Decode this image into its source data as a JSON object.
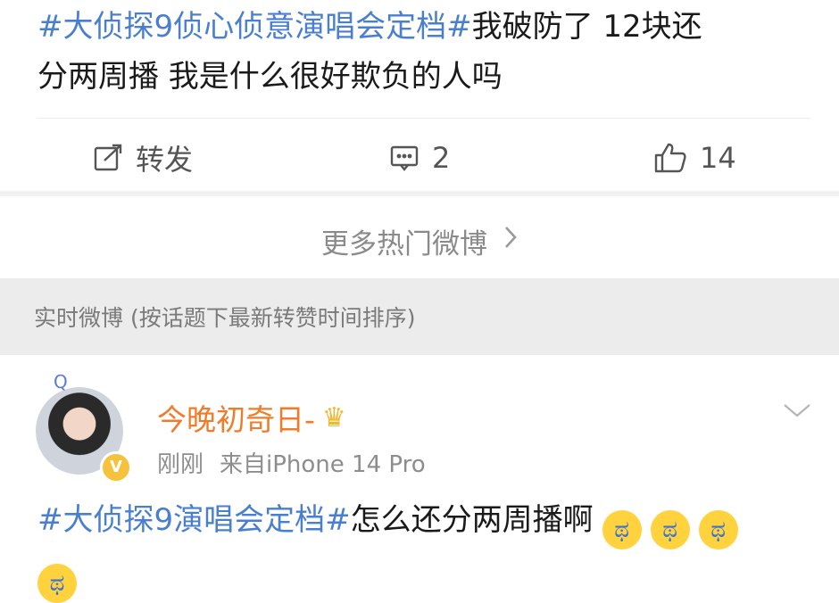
{
  "post": {
    "tag": "#大侦探9侦心侦意演唱会定档#",
    "text_line1": "我破防了 12块还",
    "text_line2": "分两周播 我是什么很好欺负的人吗"
  },
  "actions": {
    "repost_label": "转发",
    "comment_count": "2",
    "like_count": "14"
  },
  "more_hot": {
    "label": "更多热门微博",
    "arrow_icon": "chevron-right-icon"
  },
  "section": {
    "title": "实时微博 (按话题下最新转赞时间排序)"
  },
  "comment": {
    "username": "今晚初奇日-",
    "crown_icon": "crown-icon",
    "time": "刚刚",
    "source": "来自iPhone 14 Pro",
    "tag": "#大侦探9演唱会定档#",
    "text": "怎么还分两周播啊",
    "emoji_icon": "crying-face-icon",
    "emoji_count": 4,
    "avatar_deco": "Q"
  },
  "colors": {
    "tag_blue": "#4a7fcf",
    "username_orange": "#f07b2a",
    "section_bg": "#ececec"
  }
}
